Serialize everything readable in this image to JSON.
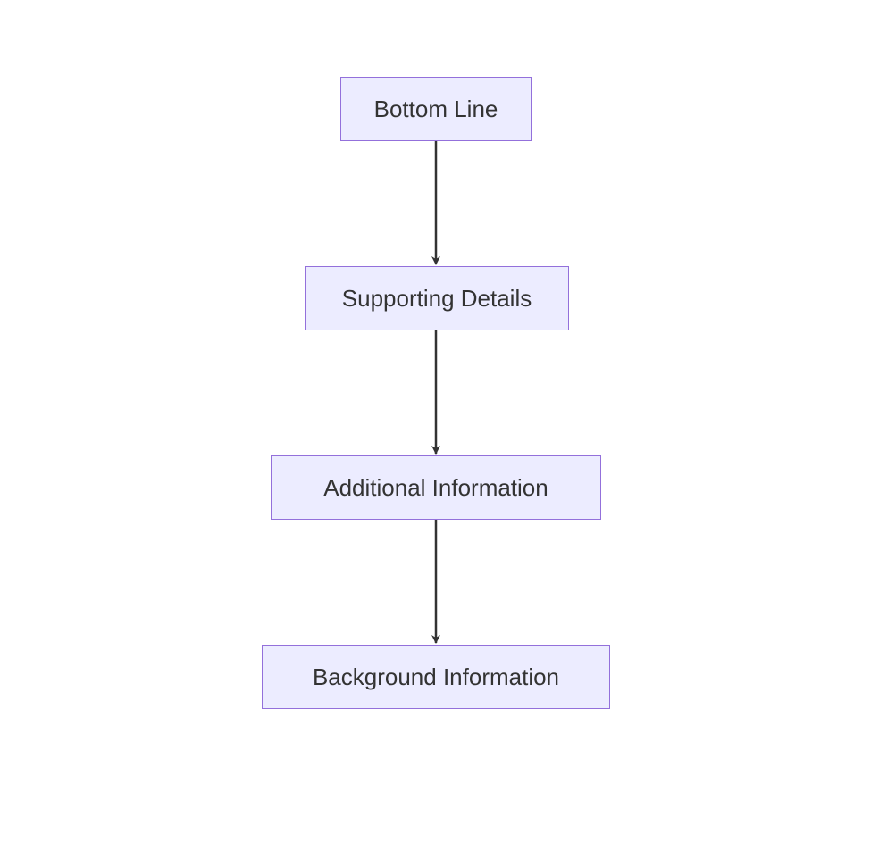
{
  "diagram": {
    "type": "flowchart",
    "direction": "TB",
    "nodes": [
      {
        "id": "a",
        "label": "Bottom Line"
      },
      {
        "id": "b",
        "label": "Supporting Details"
      },
      {
        "id": "c",
        "label": "Additional Information"
      },
      {
        "id": "d",
        "label": "Background Information"
      }
    ],
    "edges": [
      {
        "from": "a",
        "to": "b"
      },
      {
        "from": "b",
        "to": "c"
      },
      {
        "from": "c",
        "to": "d"
      }
    ],
    "style": {
      "node_fill": "#ECECFF",
      "node_stroke": "#9370DB",
      "edge_color": "#333333",
      "text_color": "#333333"
    }
  }
}
